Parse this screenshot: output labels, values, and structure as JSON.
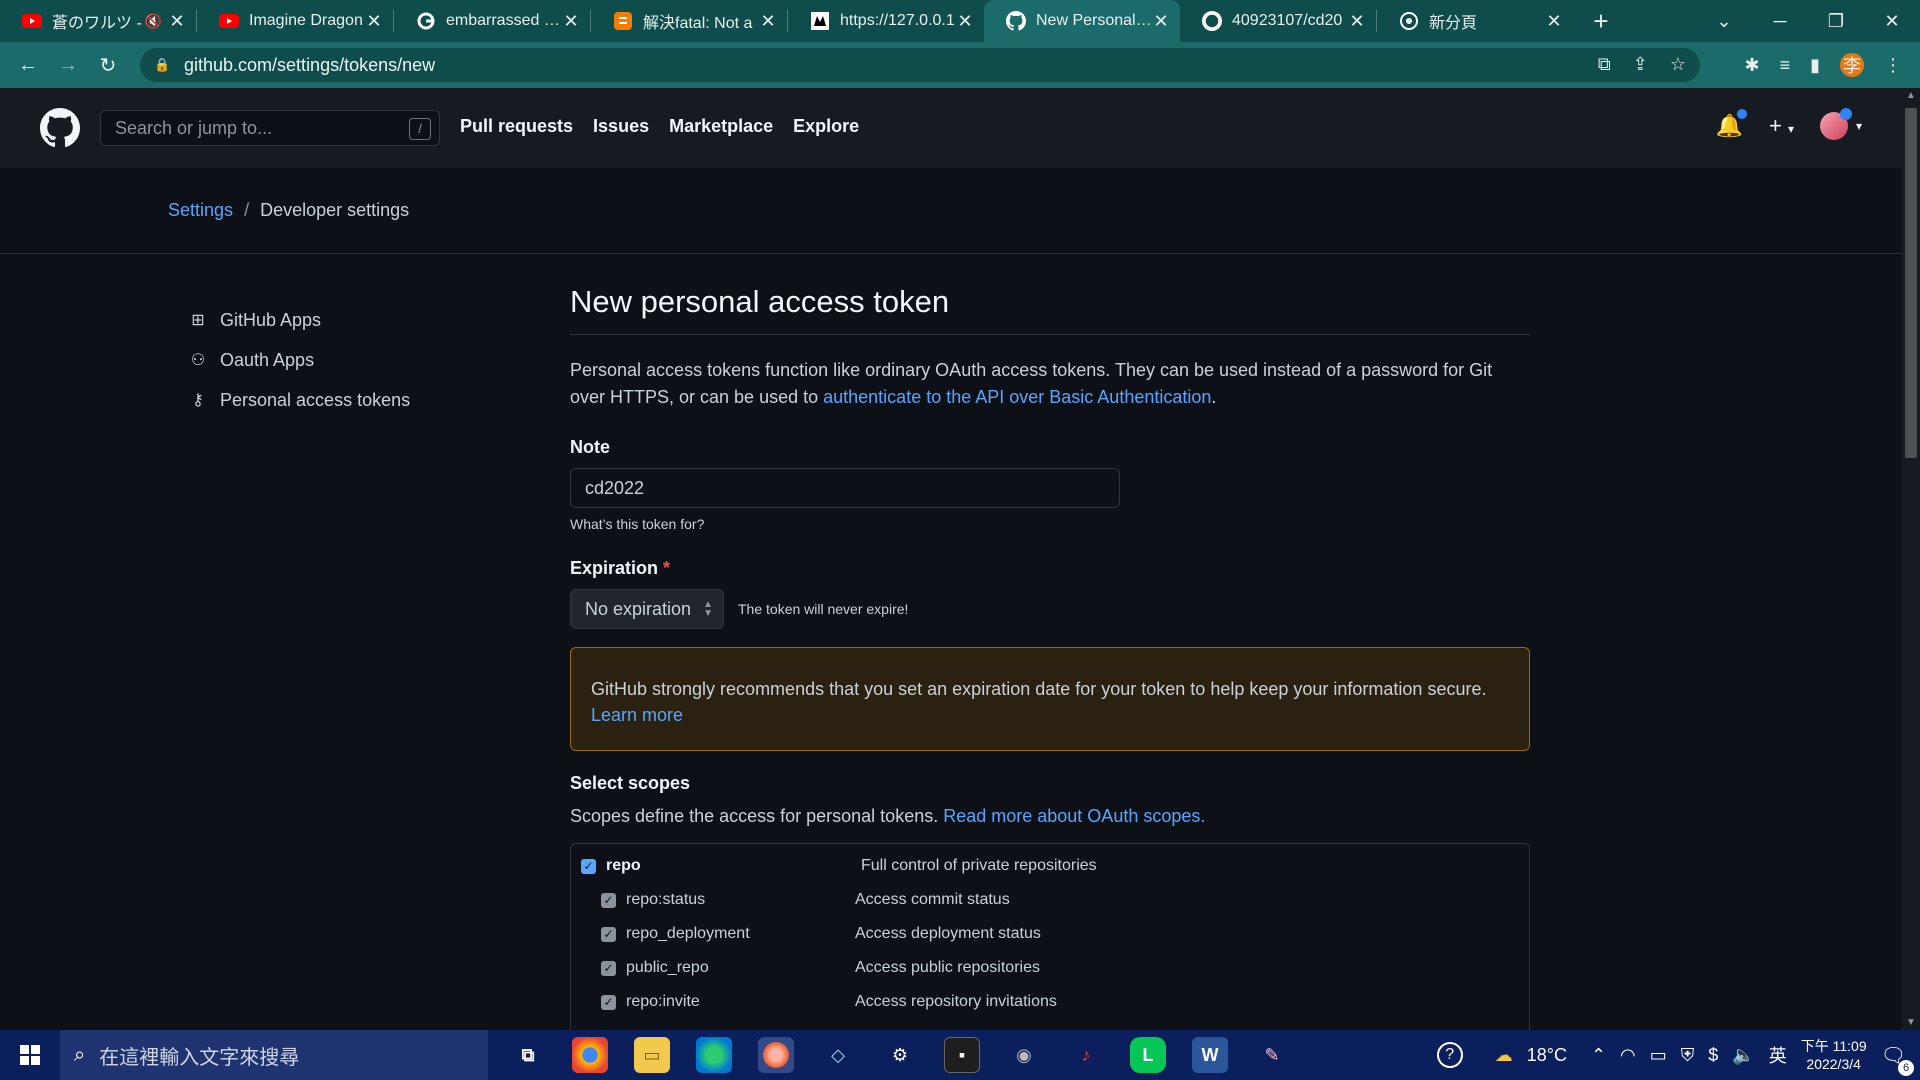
{
  "browser": {
    "tabs": [
      {
        "title": "蒼のワルツ -",
        "icon": "youtube-icon",
        "muted": true
      },
      {
        "title": "Imagine Dragon",
        "icon": "youtube-icon"
      },
      {
        "title": "embarrassed - G",
        "icon": "google-icon"
      },
      {
        "title": "解決fatal: Not a",
        "icon": "blogger-icon"
      },
      {
        "title": "https://127.0.0.1",
        "icon": "site-icon"
      },
      {
        "title": "New Personal Ac",
        "icon": "github-icon",
        "active": true
      },
      {
        "title": "40923107/cd20",
        "icon": "github-icon"
      },
      {
        "title": "新分頁",
        "icon": "chrome-icon"
      }
    ],
    "url": "github.com/settings/tokens/new",
    "profile_initial": "李"
  },
  "github": {
    "search_placeholder": "Search or jump to...",
    "search_shortcut": "/",
    "nav": [
      "Pull requests",
      "Issues",
      "Marketplace",
      "Explore"
    ]
  },
  "breadcrumb": {
    "settings": "Settings",
    "separator": "/",
    "current": "Developer settings"
  },
  "sidebar": {
    "items": [
      {
        "label": "GitHub Apps",
        "icon": "apps-icon"
      },
      {
        "label": "Oauth Apps",
        "icon": "person-icon"
      },
      {
        "label": "Personal access tokens",
        "icon": "key-icon"
      }
    ]
  },
  "form": {
    "title": "New personal access token",
    "intro_text": "Personal access tokens function like ordinary OAuth access tokens. They can be used instead of a password for Git over HTTPS, or can be used to ",
    "intro_link": "authenticate to the API over Basic Authentication",
    "intro_end": ".",
    "note_label": "Note",
    "note_value": "cd2022",
    "note_hint": "What’s this token for?",
    "expiration_label": "Expiration",
    "required_mark": "*",
    "expiration_value": "No expiration",
    "expiration_text": "The token will never expire!",
    "warning_text": "GitHub strongly recommends that you set an expiration date for your token to help keep your information secure.",
    "warning_link": "Learn more",
    "scopes_title": "Select scopes",
    "scopes_desc": "Scopes define the access for personal tokens. ",
    "scopes_link": "Read more about OAuth scopes.",
    "scopes": [
      {
        "name": "repo",
        "desc": "Full control of private repositories",
        "checked": true,
        "parent": true
      },
      {
        "name": "repo:status",
        "desc": "Access commit status",
        "checked": true
      },
      {
        "name": "repo_deployment",
        "desc": "Access deployment status",
        "checked": true
      },
      {
        "name": "public_repo",
        "desc": "Access public repositories",
        "checked": true
      },
      {
        "name": "repo:invite",
        "desc": "Access repository invitations",
        "checked": true
      }
    ]
  },
  "taskbar": {
    "search_placeholder": "在這裡輸入文字來搜尋",
    "weather": "18°C",
    "ime": "英",
    "time": "下午 11:09",
    "date": "2022/3/4",
    "notification_count": "6"
  },
  "colors": {
    "chrome_frame": "#0f4c4c",
    "chrome_active": "#1b6b6b",
    "github_bg": "#0d1117",
    "link": "#58a6ff",
    "warning_border": "#9e6a03",
    "taskbar": "#0a1f5c"
  }
}
